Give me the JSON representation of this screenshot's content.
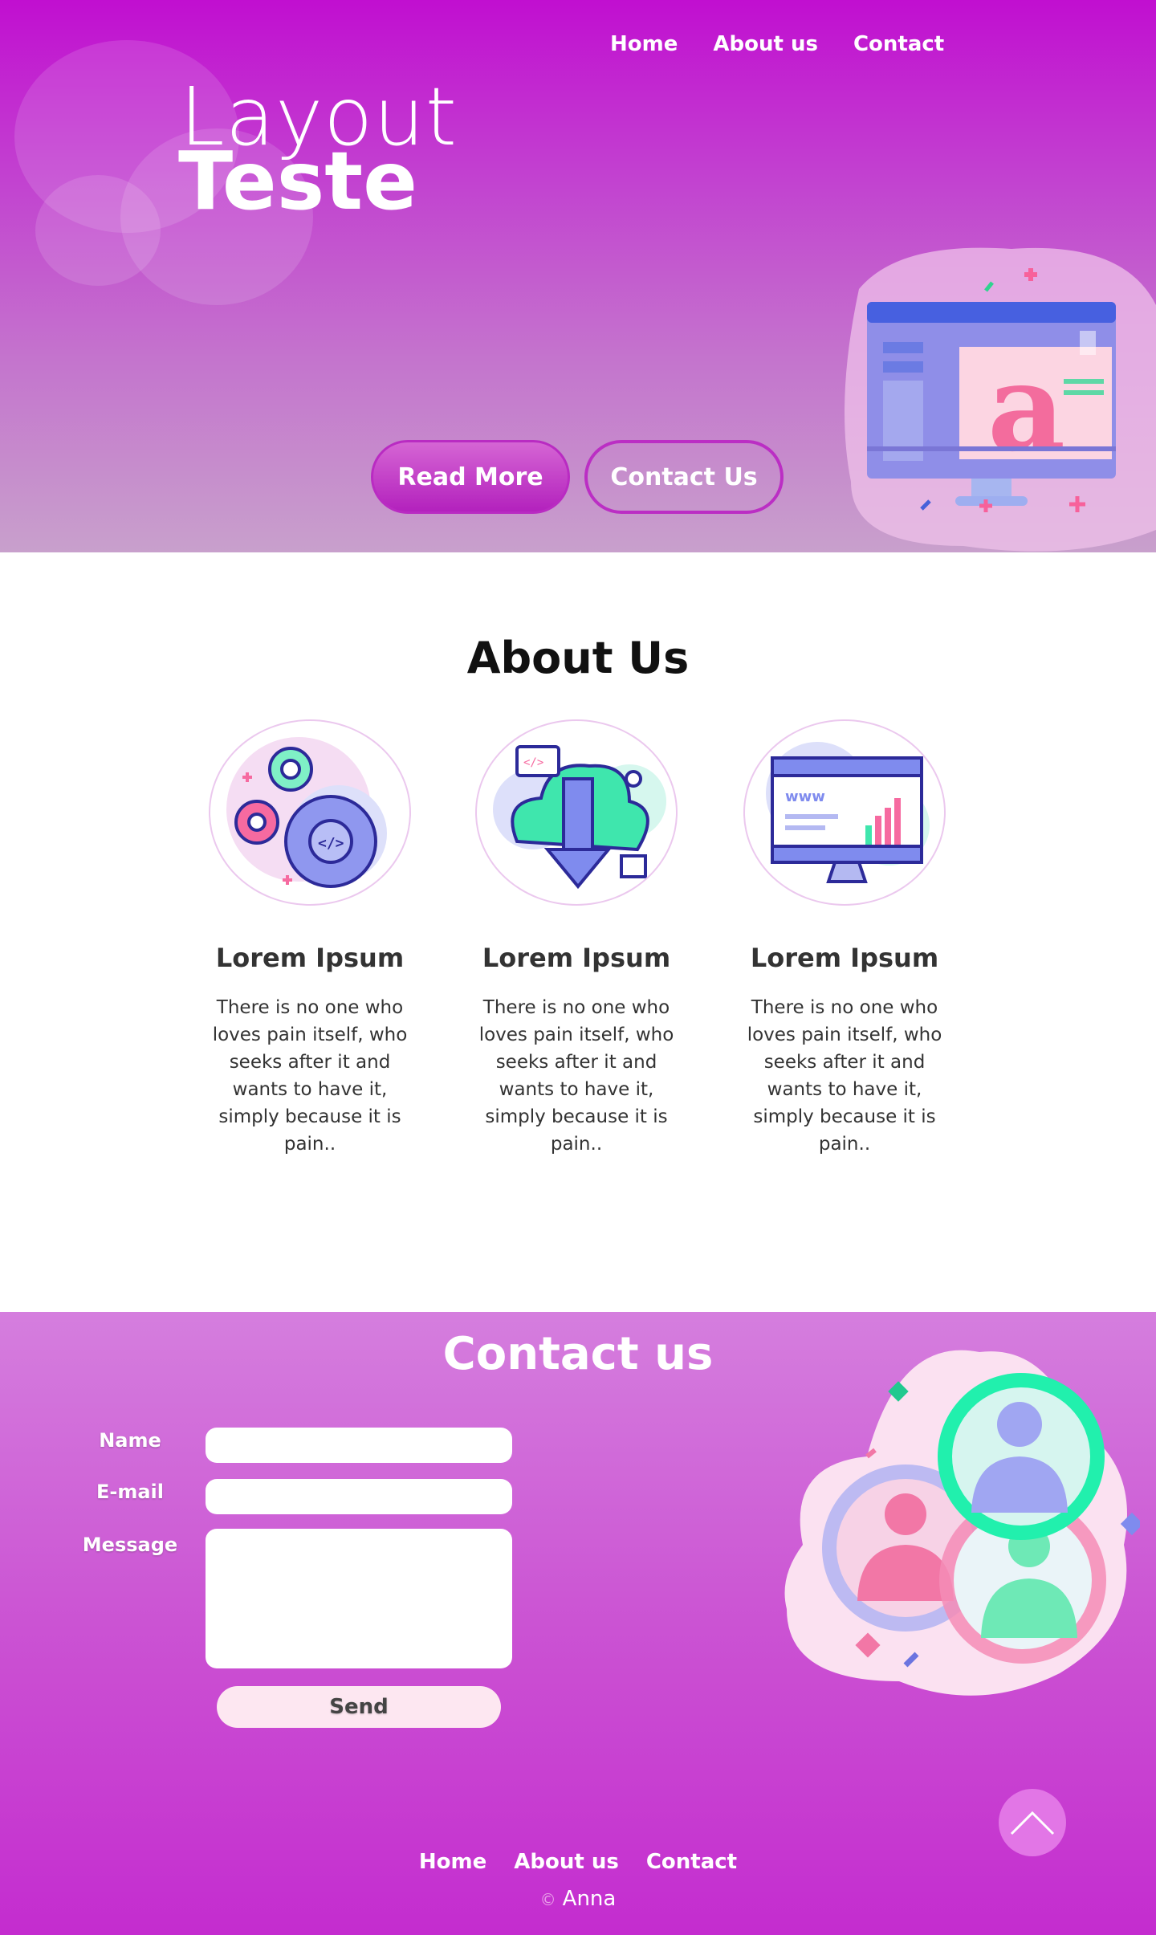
{
  "nav": {
    "items": [
      "Home",
      "About us",
      "Contact"
    ]
  },
  "hero": {
    "logo_line1": "Layout",
    "logo_line2": "Teste",
    "read_more": "Read More",
    "contact_us": "Contact Us",
    "illustration_icon": "monitor-typography-icon"
  },
  "about": {
    "title": "About Us",
    "cards": [
      {
        "icon": "gears-code-icon",
        "title": "Lorem Ipsum",
        "text": "There is no one who loves pain itself, who seeks after it and wants to have it, simply because it is pain.."
      },
      {
        "icon": "cloud-download-icon",
        "title": "Lorem Ipsum",
        "text": "There is no one who loves pain itself, who seeks after it and wants to have it, simply because it is pain.."
      },
      {
        "icon": "website-analytics-icon",
        "title": "Lorem Ipsum",
        "text": "There is no one who loves pain itself, who seeks after it and wants to have it, simply because it is pain.."
      }
    ]
  },
  "contact": {
    "title": "Contact us",
    "name_label": "Name",
    "name_value": "",
    "email_label": "E-mail",
    "email_value": "",
    "message_label": "Message",
    "message_value": "",
    "send_label": "Send",
    "illustration_icon": "people-chat-icon"
  },
  "footer": {
    "nav": [
      "Home",
      "About us",
      "Contact"
    ],
    "copyright_symbol": "©",
    "author": "Anna",
    "scroll_top_icon": "chevron-up-icon"
  },
  "colors": {
    "hero_top": "#c10fd0",
    "hero_bottom": "#c8a0cc",
    "accent": "#b92bc2",
    "contact_top": "#d57ede",
    "contact_bottom": "#c42ccf"
  }
}
